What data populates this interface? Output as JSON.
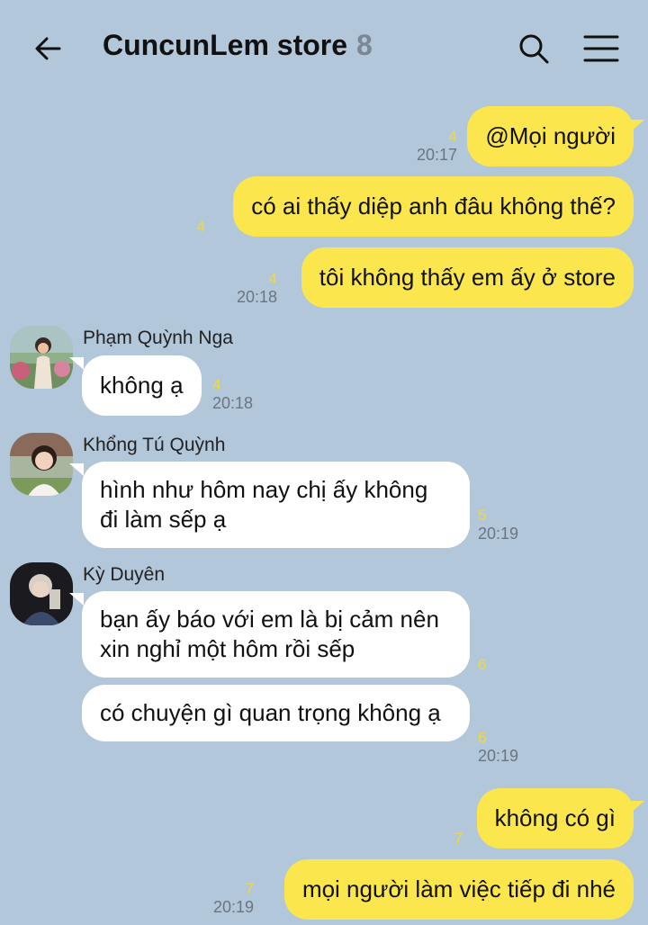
{
  "header": {
    "title": "CuncunLem store",
    "member_count": "8"
  },
  "messages": [
    {
      "side": "out",
      "text": "@Mọi người",
      "unread": "4",
      "time": "20:17"
    },
    {
      "side": "out",
      "text": "có ai thấy diệp anh đâu không thế?",
      "unread": "4",
      "time": ""
    },
    {
      "side": "out",
      "text": "tôi không thấy em ấy ở store",
      "unread": "4",
      "time": "20:18"
    },
    {
      "side": "in",
      "sender": "Phạm Quỳnh Nga",
      "text": "không ạ",
      "unread": "4",
      "time": "20:18"
    },
    {
      "side": "in",
      "sender": "Khổng Tú Quỳnh",
      "text": "hình như hôm nay chị ấy không đi làm sếp ạ",
      "unread": "5",
      "time": "20:19"
    },
    {
      "side": "in",
      "sender": "Kỳ Duyên",
      "text": "bạn ấy báo với em là bị cảm nên xin nghỉ một hôm rồi sếp",
      "unread": "6",
      "time": ""
    },
    {
      "side": "in",
      "sender": "",
      "text": "có chuyện gì quan trọng không ạ",
      "unread": "6",
      "time": "20:19"
    },
    {
      "side": "out",
      "text": "không có gì",
      "unread": "7",
      "time": ""
    },
    {
      "side": "out",
      "text": "mọi người làm việc tiếp đi nhé",
      "unread": "7",
      "time": "20:19"
    }
  ],
  "colors": {
    "background": "#b2c7da",
    "outgoing_bubble": "#fbe64e",
    "incoming_bubble": "#ffffff",
    "unread_count": "#f0d93a"
  }
}
